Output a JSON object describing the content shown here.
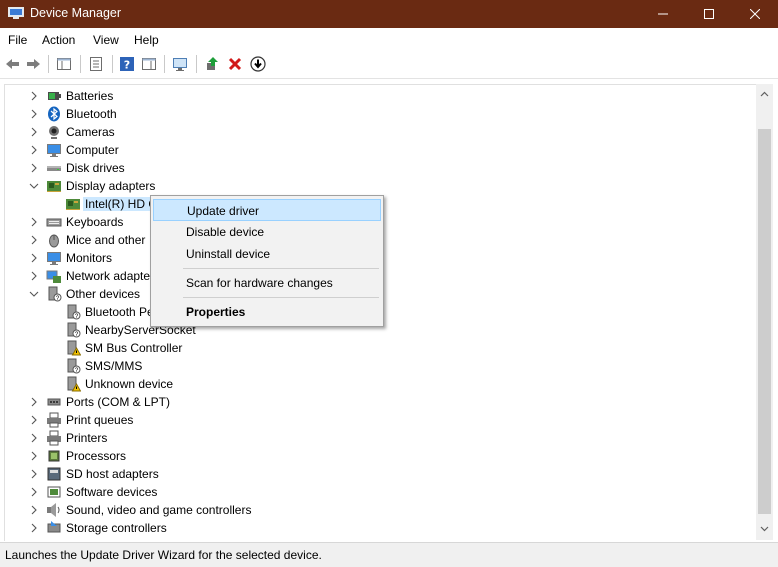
{
  "window": {
    "title": "Device Manager",
    "titlebar_color": "#6a2a12"
  },
  "menu": [
    "File",
    "Action",
    "View",
    "Help"
  ],
  "toolbar": {
    "buttons": [
      "back-icon",
      "forward-icon",
      "show-hide-console-tree-icon",
      "properties-icon",
      "help-icon",
      "action-pane-icon",
      "scan-hardware-icon",
      "update-driver-icon",
      "uninstall-icon",
      "disable-device-icon"
    ]
  },
  "tree": {
    "items": [
      {
        "label": "Batteries",
        "icon": "battery-icon",
        "level": 0,
        "state": "collapsed"
      },
      {
        "label": "Bluetooth",
        "icon": "bluetooth-icon",
        "level": 0,
        "state": "collapsed"
      },
      {
        "label": "Cameras",
        "icon": "camera-icon",
        "level": 0,
        "state": "collapsed"
      },
      {
        "label": "Computer",
        "icon": "computer-icon",
        "level": 0,
        "state": "collapsed"
      },
      {
        "label": "Disk drives",
        "icon": "disk-drive-icon",
        "level": 0,
        "state": "collapsed"
      },
      {
        "label": "Display adapters",
        "icon": "display-adapter-icon",
        "level": 0,
        "state": "expanded"
      },
      {
        "label": "Intel(R) HD G",
        "icon": "display-adapter-icon",
        "level": 1,
        "state": "selected"
      },
      {
        "label": "Keyboards",
        "icon": "keyboard-icon",
        "level": 0,
        "state": "collapsed"
      },
      {
        "label": "Mice and other",
        "icon": "mouse-icon",
        "level": 0,
        "state": "collapsed"
      },
      {
        "label": "Monitors",
        "icon": "monitor-icon",
        "level": 0,
        "state": "collapsed"
      },
      {
        "label": "Network adapte",
        "icon": "network-adapter-icon",
        "level": 0,
        "state": "collapsed"
      },
      {
        "label": "Other devices",
        "icon": "other-devices-icon",
        "level": 0,
        "state": "expanded"
      },
      {
        "label": "Bluetooth Pe",
        "icon": "unknown-device-icon",
        "level": 1,
        "state": "none"
      },
      {
        "label": "NearbyServerSocket",
        "icon": "unknown-device-icon",
        "level": 1,
        "state": "none"
      },
      {
        "label": "SM Bus Controller",
        "icon": "warning-device-icon",
        "level": 1,
        "state": "none"
      },
      {
        "label": "SMS/MMS",
        "icon": "unknown-device-icon",
        "level": 1,
        "state": "none"
      },
      {
        "label": "Unknown device",
        "icon": "warning-device-icon",
        "level": 1,
        "state": "none"
      },
      {
        "label": "Ports (COM & LPT)",
        "icon": "port-icon",
        "level": 0,
        "state": "collapsed"
      },
      {
        "label": "Print queues",
        "icon": "print-queue-icon",
        "level": 0,
        "state": "collapsed"
      },
      {
        "label": "Printers",
        "icon": "printer-icon",
        "level": 0,
        "state": "collapsed"
      },
      {
        "label": "Processors",
        "icon": "processor-icon",
        "level": 0,
        "state": "collapsed"
      },
      {
        "label": "SD host adapters",
        "icon": "sd-host-icon",
        "level": 0,
        "state": "collapsed"
      },
      {
        "label": "Software devices",
        "icon": "software-device-icon",
        "level": 0,
        "state": "collapsed"
      },
      {
        "label": "Sound, video and game controllers",
        "icon": "sound-icon",
        "level": 0,
        "state": "collapsed"
      },
      {
        "label": "Storage controllers",
        "icon": "storage-controller-icon",
        "level": 0,
        "state": "collapsed"
      }
    ]
  },
  "context_menu": {
    "update": "Update driver",
    "disable": "Disable device",
    "uninstall": "Uninstall device",
    "scan": "Scan for hardware changes",
    "properties": "Properties"
  },
  "status": "Launches the Update Driver Wizard for the selected device."
}
